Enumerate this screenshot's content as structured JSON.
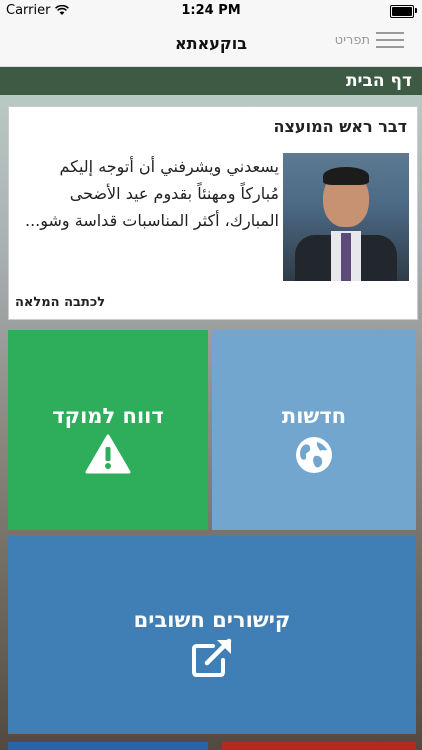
{
  "status": {
    "carrier": "Carrier",
    "time": "1:24 PM"
  },
  "nav": {
    "title": "בוקעאתא",
    "menu_label": "תפריט"
  },
  "page": {
    "title": "דף הבית"
  },
  "card": {
    "title": "דבר ראש המועצה",
    "excerpt": "يسعدني ويشرفني أن أتوجه إليكم مُباركاً ومهنئاً بقدوم عيد الأضحى المبارك، أكثر المناسبات قداسة وشو...",
    "read_more": "לכתבה המלאה"
  },
  "tiles": {
    "report": {
      "label": "דווח למוקד",
      "icon": "warning-icon",
      "color": "#2ead5b"
    },
    "news": {
      "label": "חדשות",
      "icon": "globe-icon",
      "color": "#72a6cf"
    },
    "links": {
      "label": "קישורים חשובים",
      "icon": "external-link-icon",
      "color": "#3f7fb5"
    }
  },
  "colors": {
    "header": "#3d5a45",
    "strip_left": "#2b64a6",
    "strip_right": "#b52a1c"
  }
}
